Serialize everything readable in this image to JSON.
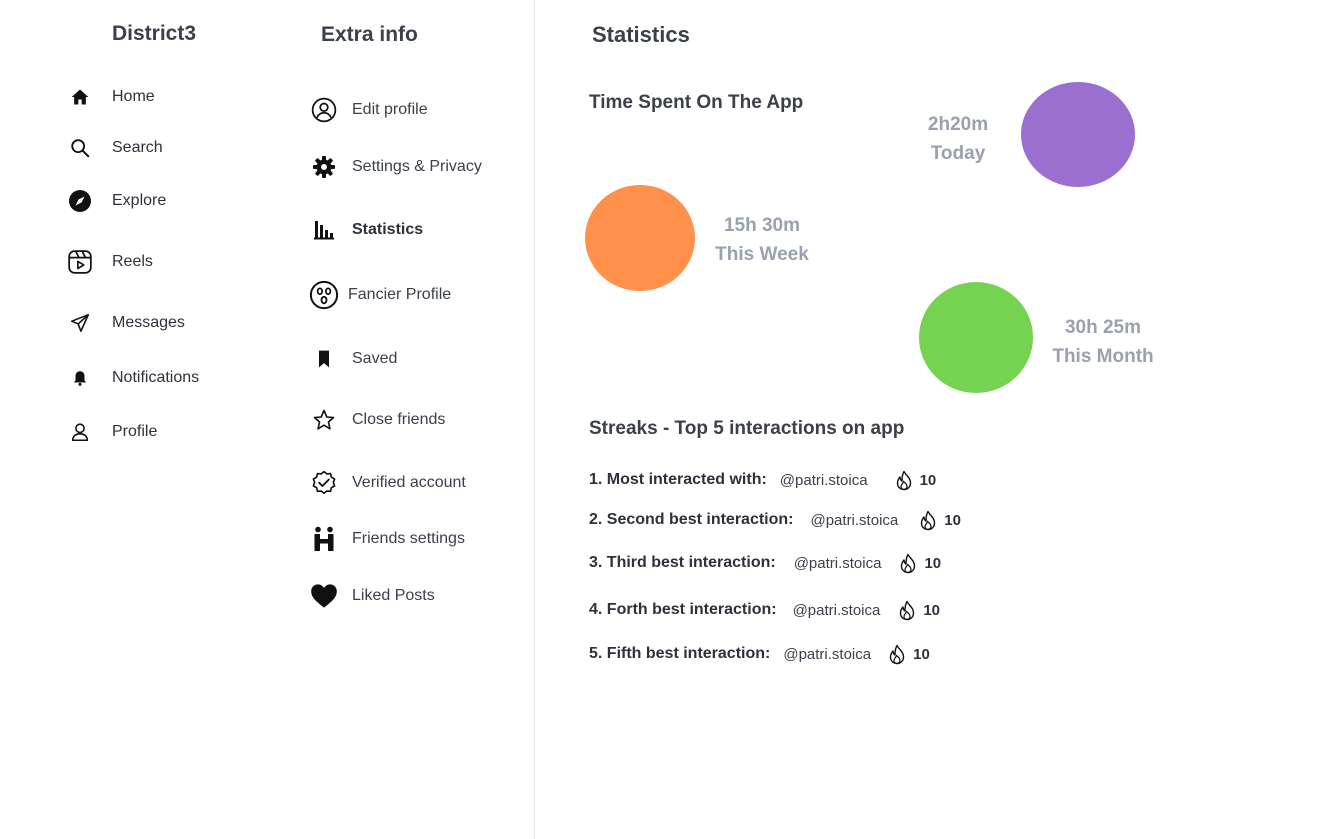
{
  "nav": {
    "title": "District3",
    "items": [
      {
        "label": "Home",
        "icon": "home-icon"
      },
      {
        "label": "Search",
        "icon": "search-icon"
      },
      {
        "label": "Explore",
        "icon": "compass-icon"
      },
      {
        "label": "Reels",
        "icon": "reels-icon"
      },
      {
        "label": "Messages",
        "icon": "send-icon"
      },
      {
        "label": "Notifications",
        "icon": "bell-icon"
      },
      {
        "label": "Profile",
        "icon": "user-icon"
      }
    ]
  },
  "extra": {
    "title": "Extra info",
    "items": [
      {
        "label": "Edit profile",
        "icon": "user-circle-icon"
      },
      {
        "label": "Settings & Privacy",
        "icon": "gear-icon"
      },
      {
        "label": "Statistics",
        "icon": "bar-chart-icon",
        "active": true
      },
      {
        "label": "Fancier Profile",
        "icon": "surprised-face-icon"
      },
      {
        "label": "Saved",
        "icon": "bookmark-icon"
      },
      {
        "label": "Close friends",
        "icon": "star-icon"
      },
      {
        "label": "Verified account",
        "icon": "verified-badge-icon"
      },
      {
        "label": "Friends settings",
        "icon": "friends-icon"
      },
      {
        "label": "Liked Posts",
        "icon": "heart-icon"
      }
    ]
  },
  "stats": {
    "title": "Statistics",
    "time_heading": "Time Spent On The App",
    "bubbles": [
      {
        "value": "2h20m",
        "period": "Today",
        "color": "#9b6fd0"
      },
      {
        "value": "15h 30m",
        "period": "This Week",
        "color": "#ff914d"
      },
      {
        "value": "30h 25m",
        "period": "This Month",
        "color": "#76d351"
      }
    ],
    "streaks_heading": "Streaks - Top 5 interactions on app",
    "streaks": [
      {
        "label": "1. Most interacted with:",
        "user": "@patri.stoica",
        "count": "10"
      },
      {
        "label": "2. Second best interaction:",
        "user": "@patri.stoica",
        "count": "10"
      },
      {
        "label": "3. Third best interaction:",
        "user": "@patri.stoica",
        "count": "10"
      },
      {
        "label": "4. Forth best interaction:",
        "user": "@patri.stoica",
        "count": "10"
      },
      {
        "label": "5. Fifth best interaction:",
        "user": "@patri.stoica",
        "count": "10"
      }
    ]
  }
}
